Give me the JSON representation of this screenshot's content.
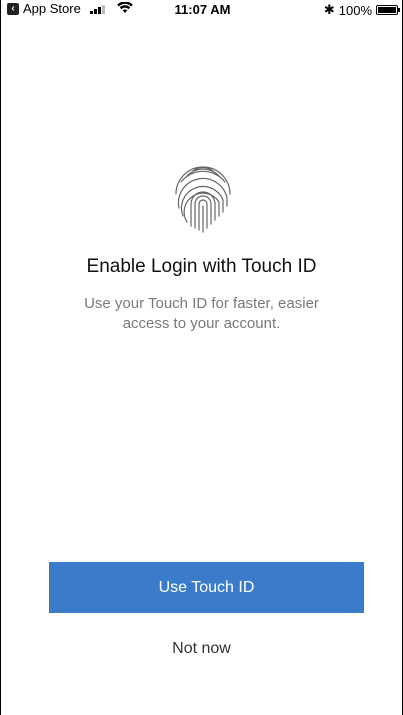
{
  "status_bar": {
    "back_label": "App Store",
    "time": "11:07 AM",
    "bluetooth": "✱",
    "battery_text": "100%"
  },
  "main": {
    "icon": "fingerprint-icon",
    "title": "Enable Login with Touch ID",
    "subtitle": "Use your Touch ID for faster, easier access to your account.",
    "primary_button": "Use Touch ID",
    "secondary_button": "Not now"
  },
  "colors": {
    "accent": "#3a7cc9",
    "subtitle": "#7a7a7a"
  }
}
